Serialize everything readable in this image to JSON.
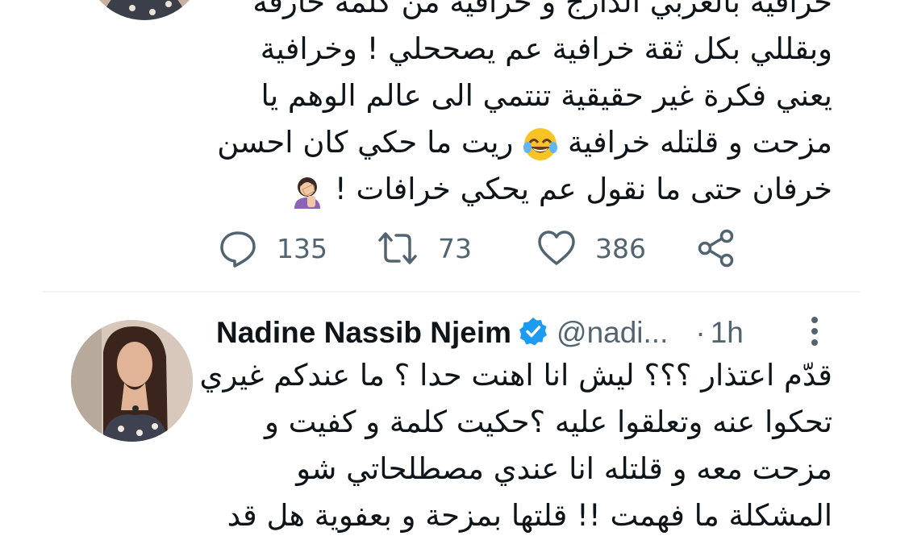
{
  "tweet_top": {
    "lines": [
      "خرافية بالعربي الدارج و خرافية من كلمة خارقة",
      "وبقللي بكل ثقة خرافية عم يصححلي ! وخرافية",
      "يعني فكرة غير حقيقية تنتمي الى عالم الوهم يا",
      "ريت ما حكي كان احسن",
      "مزحت و قلتله خرافية",
      "خرفان حتى ما نقول عم يحكي خرافات !"
    ],
    "emoji_laugh": "face-with-tears-of-joy-emoji",
    "emoji_facepalm": "woman-facepalming-emoji",
    "actions": {
      "replies": "135",
      "retweets": "73",
      "likes": "386"
    }
  },
  "tweet_second": {
    "author_name": "Nadine Nassib Njeim",
    "handle": "@nadi...",
    "separator": "·",
    "time": "1h",
    "lines": [
      "قدّم اعتذار ؟؟؟ ليش انا اهنت حدا ؟ ما عندكم غيري",
      "تحكوا عنه وتعلقوا عليه ؟حكيت كلمة و كفيت و",
      "مزحت معه و قلتله انا عندي مصطلحاتي شو",
      "المشكلة ما فهمت !! قلتها بمزحة و بعفوية هل قد"
    ]
  },
  "colors": {
    "text": "#0f1419",
    "secondary": "#536471",
    "verified": "#1d9bf0",
    "divider": "#eff3f4"
  }
}
